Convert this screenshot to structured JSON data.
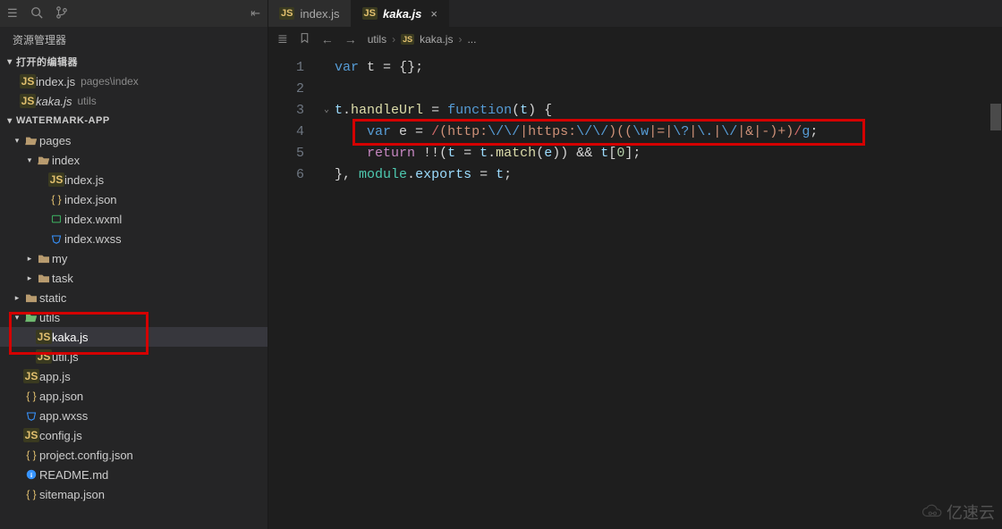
{
  "sidebar": {
    "explorer_label": "资源管理器",
    "open_editors_label": "打开的编辑器",
    "project_label": "WATERMARK-APP",
    "open_editors": [
      {
        "name": "index.js",
        "path": "pages\\index",
        "icon": "js"
      },
      {
        "name": "kaka.js",
        "path": "utils",
        "icon": "js",
        "italic": true
      }
    ],
    "tree": [
      {
        "depth": 0,
        "chev": "down",
        "icon": "folder-open",
        "iconClass": "ic-folder",
        "label": "pages"
      },
      {
        "depth": 1,
        "chev": "down",
        "icon": "folder-open",
        "iconClass": "ic-folder-open",
        "label": "index"
      },
      {
        "depth": 2,
        "chev": "",
        "icon": "js",
        "iconClass": "ic-js",
        "label": "index.js"
      },
      {
        "depth": 2,
        "chev": "",
        "icon": "json",
        "iconClass": "ic-json",
        "label": "index.json"
      },
      {
        "depth": 2,
        "chev": "",
        "icon": "wxml",
        "iconClass": "ic-wxml",
        "label": "index.wxml"
      },
      {
        "depth": 2,
        "chev": "",
        "icon": "wxss",
        "iconClass": "ic-wxss",
        "label": "index.wxss"
      },
      {
        "depth": 1,
        "chev": "right",
        "icon": "folder",
        "iconClass": "ic-folder",
        "label": "my"
      },
      {
        "depth": 1,
        "chev": "right",
        "icon": "folder",
        "iconClass": "ic-folder",
        "label": "task"
      },
      {
        "depth": 0,
        "chev": "right",
        "icon": "folder",
        "iconClass": "ic-folder",
        "label": "static"
      },
      {
        "depth": 0,
        "chev": "down",
        "icon": "folder-open",
        "iconClass": "ic-folder-green",
        "label": "utils"
      },
      {
        "depth": 1,
        "chev": "",
        "icon": "js",
        "iconClass": "ic-js",
        "label": "kaka.js",
        "active": true
      },
      {
        "depth": 1,
        "chev": "",
        "icon": "js",
        "iconClass": "ic-js",
        "label": "util.js"
      },
      {
        "depth": 0,
        "chev": "",
        "icon": "js",
        "iconClass": "ic-js",
        "label": "app.js"
      },
      {
        "depth": 0,
        "chev": "",
        "icon": "json",
        "iconClass": "ic-json",
        "label": "app.json"
      },
      {
        "depth": 0,
        "chev": "",
        "icon": "wxss",
        "iconClass": "ic-wxss",
        "label": "app.wxss"
      },
      {
        "depth": 0,
        "chev": "",
        "icon": "js",
        "iconClass": "ic-js",
        "label": "config.js"
      },
      {
        "depth": 0,
        "chev": "",
        "icon": "json",
        "iconClass": "ic-json",
        "label": "project.config.json"
      },
      {
        "depth": 0,
        "chev": "",
        "icon": "info",
        "iconClass": "ic-info",
        "label": "README.md"
      },
      {
        "depth": 0,
        "chev": "",
        "icon": "json",
        "iconClass": "ic-json",
        "label": "sitemap.json"
      }
    ]
  },
  "tabs": [
    {
      "label": "index.js",
      "icon": "js",
      "active": false
    },
    {
      "label": "kaka.js",
      "icon": "js",
      "active": true,
      "italic": true,
      "close": "×"
    }
  ],
  "breadcrumbs": {
    "parts": [
      "utils",
      "kaka.js",
      "..."
    ],
    "file_icon": "js"
  },
  "code": {
    "line_numbers": [
      "1",
      "2",
      "3",
      "4",
      "5",
      "6"
    ],
    "lines_raw": [
      "var t = {};",
      "",
      "t.handleUrl = function(t) {",
      "    var e = /(http:\\/\\/|https:\\/\\/)((\\w|=|\\?|\\.|\\/|&|-)+)/g;",
      "    return !!(t = t.match(e)) && t[0];",
      "}, module.exports = t;"
    ]
  },
  "watermark": "亿速云"
}
